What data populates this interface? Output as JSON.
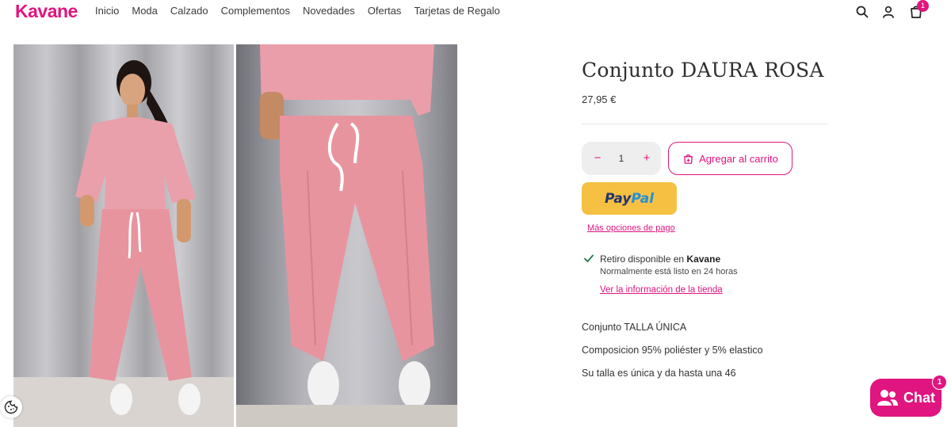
{
  "brand": {
    "name": "Kavane",
    "accent": "#e0157f"
  },
  "nav": {
    "items": [
      "Inicio",
      "Moda",
      "Calzado",
      "Complementos",
      "Novedades",
      "Ofertas",
      "Tarjetas de Regalo"
    ]
  },
  "header_icons": {
    "search": "search-icon",
    "account": "user-icon",
    "cart": "cart-icon",
    "cart_count": "1"
  },
  "gallery": {
    "images": [
      {
        "icon": "product-photo-full"
      },
      {
        "icon": "product-photo-detail"
      }
    ]
  },
  "product": {
    "title": "Conjunto DAURA ROSA",
    "price": "27,95 €",
    "quantity": "1",
    "add_to_cart_label": "Agregar al carrito",
    "paypal_pay": "Pay",
    "paypal_pal": "Pal",
    "more_payment_options": "Más opciones de pago"
  },
  "pickup": {
    "label": "Retiro disponible en",
    "store": "Kavane",
    "eta": "Normalmente está listo en 24 horas",
    "store_info_link": "Ver la información de la tienda"
  },
  "description": [
    "Conjunto TALLA ÚNICA",
    "Composicion 95% poliéster y 5% elastico",
    "Su talla es única y da hasta una 46"
  ],
  "chat": {
    "label": "Chat",
    "badge": "1"
  }
}
